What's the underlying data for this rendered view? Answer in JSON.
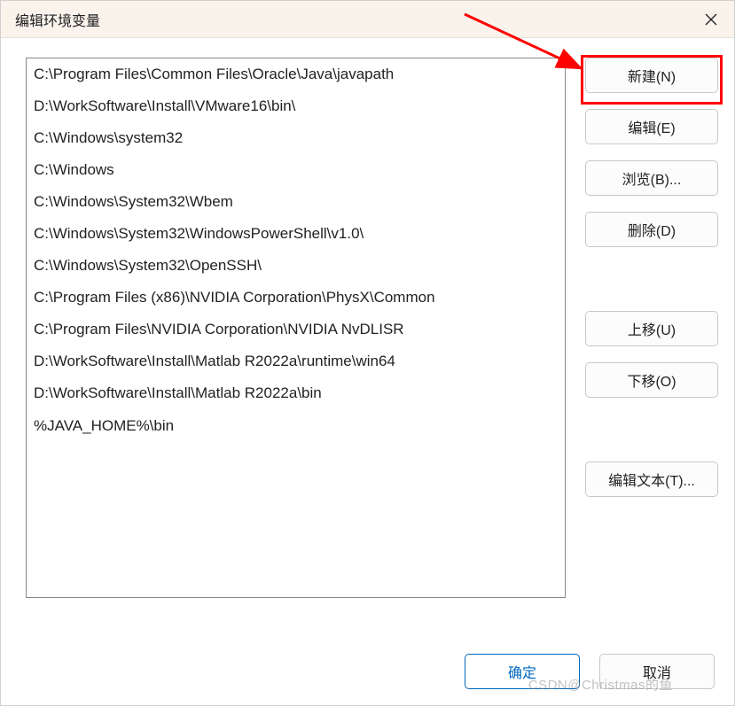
{
  "titlebar": {
    "title": "编辑环境变量"
  },
  "paths": [
    "C:\\Program Files\\Common Files\\Oracle\\Java\\javapath",
    "D:\\WorkSoftware\\Install\\VMware16\\bin\\",
    "C:\\Windows\\system32",
    "C:\\Windows",
    "C:\\Windows\\System32\\Wbem",
    "C:\\Windows\\System32\\WindowsPowerShell\\v1.0\\",
    "C:\\Windows\\System32\\OpenSSH\\",
    "C:\\Program Files (x86)\\NVIDIA Corporation\\PhysX\\Common",
    "C:\\Program Files\\NVIDIA Corporation\\NVIDIA NvDLISR",
    "D:\\WorkSoftware\\Install\\Matlab R2022a\\runtime\\win64",
    "D:\\WorkSoftware\\Install\\Matlab R2022a\\bin",
    "%JAVA_HOME%\\bin"
  ],
  "buttons": {
    "new": "新建(N)",
    "edit": "编辑(E)",
    "browse": "浏览(B)...",
    "delete": "删除(D)",
    "moveup": "上移(U)",
    "movedown": "下移(O)",
    "edittext": "编辑文本(T)...",
    "ok": "确定",
    "cancel": "取消"
  },
  "watermark": "CSDN@Christmas的鱼"
}
